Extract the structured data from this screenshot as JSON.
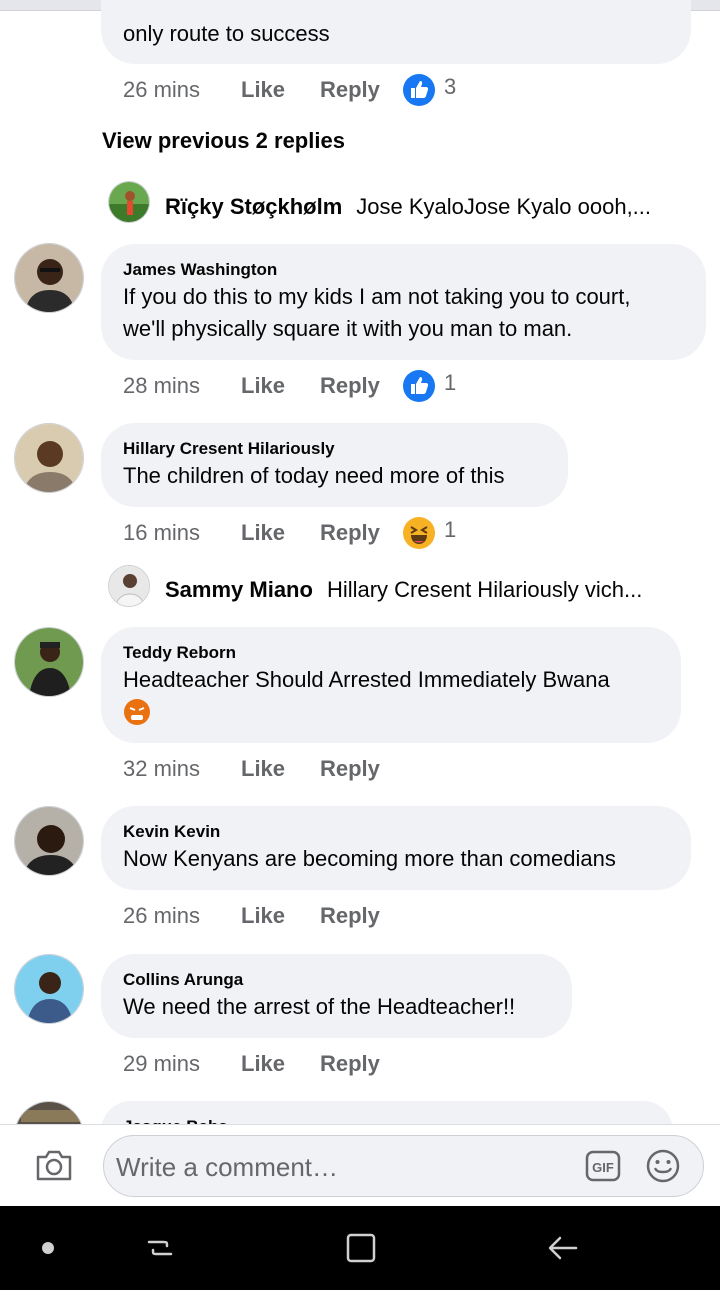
{
  "comments": [
    {
      "text": "only route to success",
      "time": "26 mins",
      "like": "Like",
      "reply": "Reply",
      "reaction": "like-icon",
      "count": "3"
    },
    {
      "author": "James Washington",
      "line1": "If you do this to my kids I am not taking you to court,",
      "line2": "we'll physically square it with you man to man.",
      "time": "28 mins",
      "like": "Like",
      "reply": "Reply",
      "reaction": "like-icon",
      "count": "1"
    },
    {
      "author": "Hillary Cresent Hilariously",
      "line1": "The children of today need more of this",
      "time": "16 mins",
      "like": "Like",
      "reply": "Reply",
      "reaction": "haha-icon",
      "count": "1"
    },
    {
      "author": "Teddy Reborn",
      "line1": "Headteacher Should Arrested Immediately Bwana",
      "time": "32 mins",
      "like": "Like",
      "reply": "Reply"
    },
    {
      "author": "Kevin Kevin",
      "line1": "Now Kenyans are becoming more than comedians",
      "time": "26 mins",
      "like": "Like",
      "reply": "Reply"
    },
    {
      "author": "Collins Arunga",
      "line1": "We need the arrest of the Headteacher!!",
      "time": "29 mins",
      "like": "Like",
      "reply": "Reply"
    },
    {
      "author": "Jasque Baba"
    }
  ],
  "view_previous": "View previous 2 replies",
  "replies": [
    {
      "name": "Rïçky Støçkhølm",
      "text": "Jose KyaloJose Kyalo oooh,..."
    },
    {
      "name": "Sammy Miano",
      "text": "Hillary Cresent Hilariously vich..."
    }
  ],
  "composer": {
    "placeholder": "Write a comment…",
    "camera_icon": "camera-icon",
    "gif_icon": "gif-icon",
    "emoji_icon": "emoji-icon"
  },
  "colors": {
    "bubble": "#f0f2f5",
    "meta": "#65676b",
    "like_blue": "#1877f2",
    "haha_yellow": "#f7b125"
  }
}
